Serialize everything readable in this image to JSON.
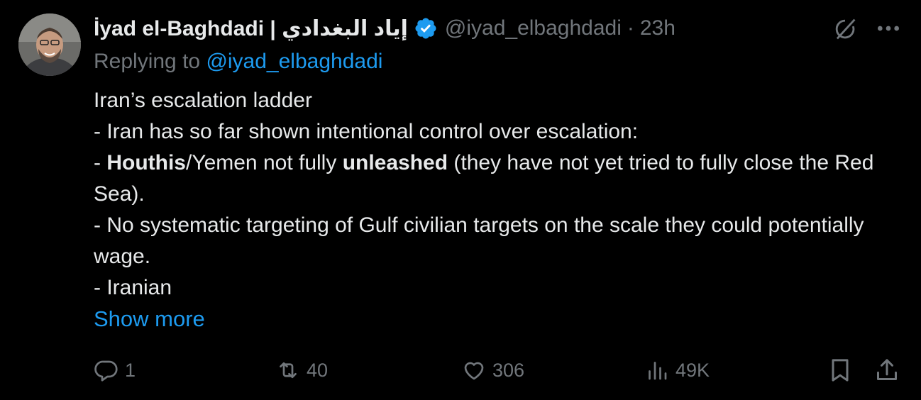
{
  "author": {
    "name": "İyad el-Baghdadi | إياد البغدادي",
    "handle": "@iyad_elbaghdadi",
    "separator": "·",
    "time": "23h",
    "verified": true,
    "verified_color": "#1d9bf0",
    "avatar_icon": "avatar-photo"
  },
  "reply": {
    "prefix": "Replying to ",
    "mention": "@iyad_elbaghdadi"
  },
  "tweet": {
    "line1": "Iran’s escalation ladder",
    "line2": "- Iran has so far shown intentional control over escalation:",
    "line3_prefix": "- ",
    "line3_bold1": "Houthis",
    "line3_mid": "/Yemen not fully ",
    "line3_bold2": "unleashed",
    "line3_rest": " (they have not yet tried to fully close the Red Sea).",
    "line4": "- No systematic targeting of Gulf civilian targets on the scale they could potentially wage.",
    "line5": "- Iranian",
    "show_more": "Show more"
  },
  "actions": {
    "replies": "1",
    "retweets": "40",
    "likes": "306",
    "views": "49K"
  },
  "colors": {
    "background": "#000000",
    "text": "#e7e9ea",
    "muted": "#71767b",
    "accent": "#1d9bf0"
  },
  "icons": [
    "grok-icon",
    "more-icon",
    "reply-icon",
    "retweet-icon",
    "like-icon",
    "views-icon",
    "bookmark-icon",
    "share-icon"
  ]
}
